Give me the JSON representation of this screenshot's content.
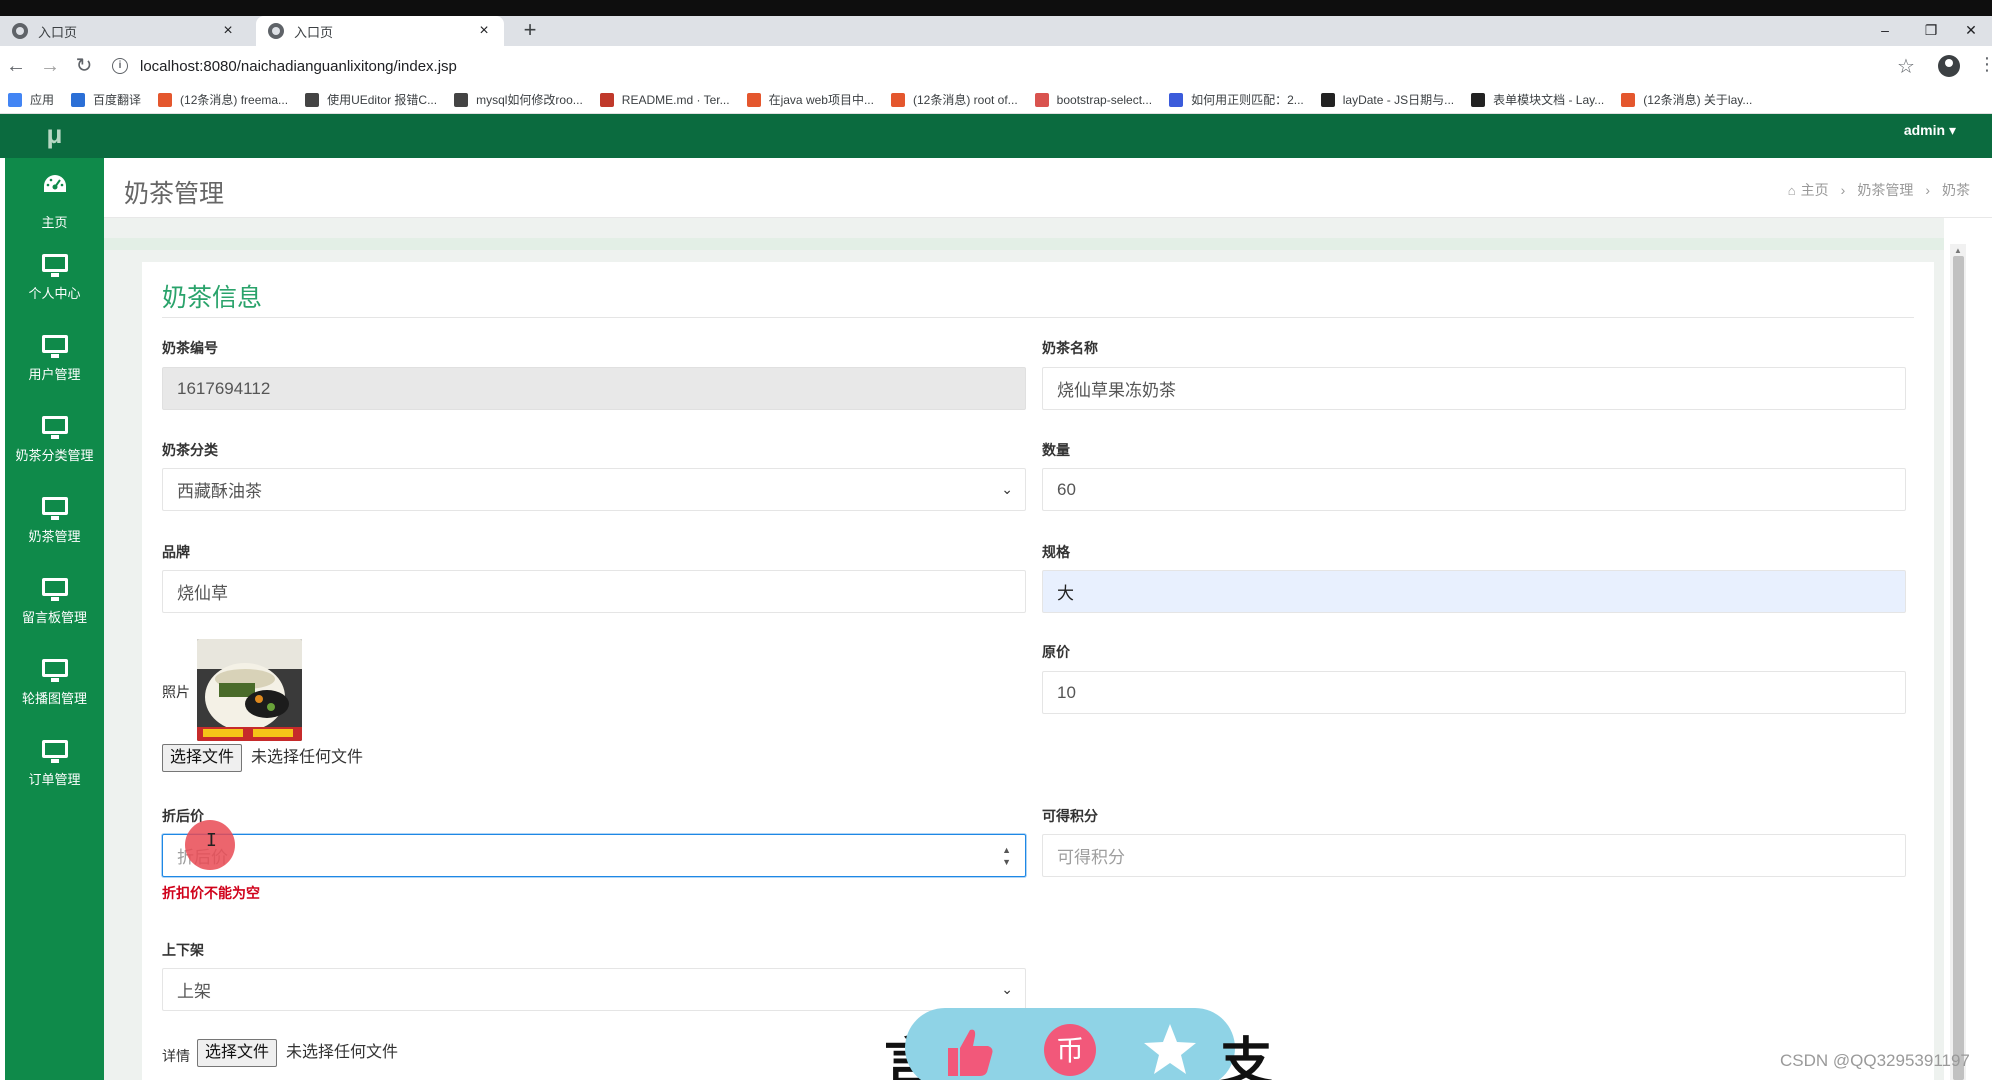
{
  "browser": {
    "tabs": [
      {
        "title": "入口页",
        "close": "×"
      },
      {
        "title": "入口页",
        "close": "×"
      }
    ],
    "new_tab": "+",
    "window_controls": {
      "minimize": "–",
      "restore": "❐",
      "close": "✕"
    },
    "url": "localhost:8080/naichadianguanlixitong/index.jsp",
    "bookmarks": [
      {
        "label": "应用",
        "color": "#4285f4"
      },
      {
        "label": "百度翻译",
        "color": "#2b6fd6"
      },
      {
        "label": "(12条消息) freema...",
        "color": "#e4572e"
      },
      {
        "label": "使用UEditor 报错C...",
        "color": "#444444"
      },
      {
        "label": "mysql如何修改roo...",
        "color": "#444444"
      },
      {
        "label": "README.md · Ter...",
        "color": "#c0392b"
      },
      {
        "label": "在java web项目中...",
        "color": "#e4572e"
      },
      {
        "label": "(12条消息) root of...",
        "color": "#e4572e"
      },
      {
        "label": "bootstrap-select...",
        "color": "#d9534f"
      },
      {
        "label": "如何用正则匹配：2...",
        "color": "#3b5bdb"
      },
      {
        "label": "layDate - JS日期与...",
        "color": "#222222"
      },
      {
        "label": "表单模块文档 - Lay...",
        "color": "#222222"
      },
      {
        "label": "(12条消息) 关于lay...",
        "color": "#e4572e"
      }
    ]
  },
  "header": {
    "logo": "μ",
    "user": "admin ▾"
  },
  "sidebar": {
    "items": [
      {
        "label": "主页",
        "icon": "dashboard-icon"
      },
      {
        "label": "个人中心",
        "icon": "monitor-icon"
      },
      {
        "label": "用户管理",
        "icon": "monitor-icon"
      },
      {
        "label": "奶茶分类管理",
        "icon": "monitor-icon"
      },
      {
        "label": "奶茶管理",
        "icon": "monitor-icon"
      },
      {
        "label": "留言板管理",
        "icon": "monitor-icon"
      },
      {
        "label": "轮播图管理",
        "icon": "monitor-icon"
      },
      {
        "label": "订单管理",
        "icon": "monitor-icon"
      }
    ]
  },
  "page": {
    "title": "奶茶管理",
    "breadcrumb": [
      "主页",
      "奶茶管理",
      "奶茶"
    ]
  },
  "form": {
    "title": "奶茶信息",
    "fields": {
      "code": {
        "label": "奶茶编号",
        "value": "1617694112"
      },
      "name": {
        "label": "奶茶名称",
        "value": "烧仙草果冻奶茶"
      },
      "category": {
        "label": "奶茶分类",
        "value": "西藏酥油茶"
      },
      "quantity": {
        "label": "数量",
        "value": "60"
      },
      "brand": {
        "label": "品牌",
        "value": "烧仙草"
      },
      "spec": {
        "label": "规格",
        "value": "大"
      },
      "photo": {
        "label": "照片",
        "button": "选择文件",
        "file_text": "未选择任何文件"
      },
      "original_price": {
        "label": "原价",
        "value": "10"
      },
      "discount_price": {
        "label": "折后价",
        "placeholder": "折后价",
        "error": "折扣价不能为空"
      },
      "points": {
        "label": "可得积分",
        "placeholder": "可得积分"
      },
      "shelf": {
        "label": "上下架",
        "value": "上架"
      },
      "details": {
        "label": "详情",
        "button": "选择文件",
        "file_text": "未选择任何文件"
      }
    }
  },
  "overlay": {
    "left": "言",
    "right": "支"
  },
  "watermark": "CSDN @QQ3295391197"
}
